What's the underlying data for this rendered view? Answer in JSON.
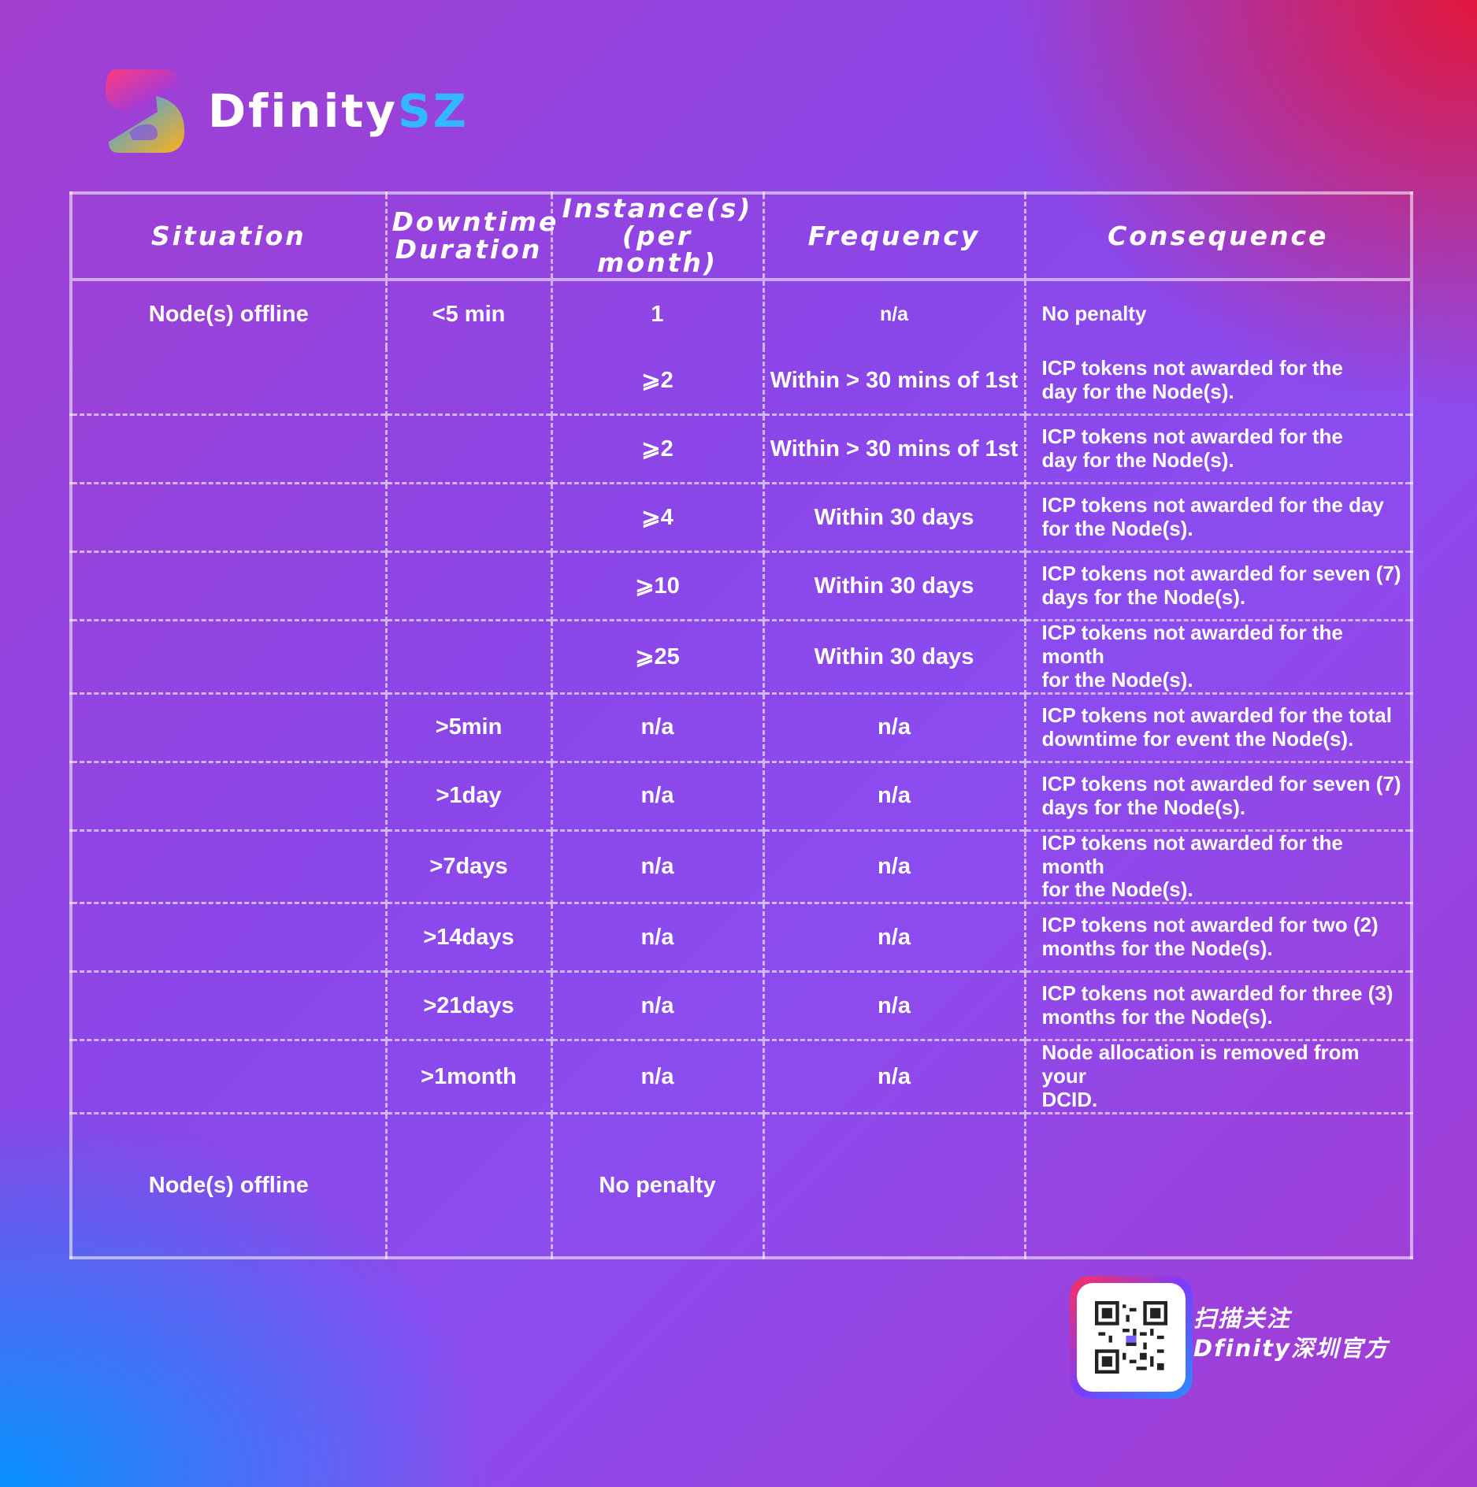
{
  "brand": {
    "name_main": "Dfinity",
    "name_accent": "SZ"
  },
  "table": {
    "headers": {
      "situation": "Situation",
      "downtime_1": "Downtime",
      "downtime_2": "Duration",
      "instances_1": "Instance(s)",
      "instances_2": "(per month)",
      "frequency": "Frequency",
      "consequence": "Consequence"
    },
    "rows": [
      {
        "situation": "Node(s) offline",
        "duration": "<5 min",
        "instances": "1",
        "frequency": "n/a",
        "consequence_1": "No penalty",
        "consequence_2": ""
      },
      {
        "situation": "",
        "duration": "",
        "instances": "⩾2",
        "frequency": "Within > 30 mins of 1st",
        "consequence_1": "ICP tokens not awarded for the",
        "consequence_2": "day for the Node(s)."
      },
      {
        "situation": "",
        "duration": "",
        "instances": "⩾2",
        "frequency": "Within > 30 mins of 1st",
        "consequence_1": "ICP tokens not awarded for the",
        "consequence_2": "day for the Node(s)."
      },
      {
        "situation": "",
        "duration": "",
        "instances": "⩾4",
        "frequency": "Within 30 days",
        "consequence_1": "ICP tokens not awarded for the day",
        "consequence_2": "for the Node(s)."
      },
      {
        "situation": "",
        "duration": "",
        "instances": "⩾10",
        "frequency": "Within 30 days",
        "consequence_1": "ICP tokens not awarded for seven (7)",
        "consequence_2": "days for the Node(s)."
      },
      {
        "situation": "",
        "duration": "",
        "instances": "⩾25",
        "frequency": "Within 30 days",
        "consequence_1": "ICP tokens not awarded for the month",
        "consequence_2": "for the Node(s)."
      },
      {
        "situation": "",
        "duration": ">5min",
        "instances": "n/a",
        "frequency": "n/a",
        "consequence_1": "ICP tokens not awarded for the total",
        "consequence_2": "downtime for event the Node(s)."
      },
      {
        "situation": "",
        "duration": ">1day",
        "instances": "n/a",
        "frequency": "n/a",
        "consequence_1": "ICP tokens not awarded for seven (7)",
        "consequence_2": "days for the Node(s)."
      },
      {
        "situation": "",
        "duration": ">7days",
        "instances": "n/a",
        "frequency": "n/a",
        "consequence_1": "ICP tokens not awarded for the month",
        "consequence_2": "for the Node(s)."
      },
      {
        "situation": "",
        "duration": ">14days",
        "instances": "n/a",
        "frequency": "n/a",
        "consequence_1": "ICP tokens not awarded for two (2)",
        "consequence_2": "months for the Node(s)."
      },
      {
        "situation": "",
        "duration": ">21days",
        "instances": "n/a",
        "frequency": "n/a",
        "consequence_1": "ICP tokens not awarded for three (3)",
        "consequence_2": "months for the Node(s)."
      },
      {
        "situation": "",
        "duration": ">1month",
        "instances": "n/a",
        "frequency": "n/a",
        "consequence_1": "Node allocation is removed from your",
        "consequence_2": "DCID."
      },
      {
        "situation": "Node(s) offline",
        "duration": "",
        "instances": "No penalty",
        "frequency": "",
        "consequence_1": "",
        "consequence_2": ""
      }
    ]
  },
  "qr": {
    "line1": "扫描关注",
    "line2": "Dfinity深圳官方",
    "icon": "qr-code-icon"
  },
  "colors": {
    "accent": "#33b8ff",
    "logo_pink": "#e8326c",
    "logo_blue": "#2ea2ff",
    "logo_orange": "#ffb019"
  }
}
